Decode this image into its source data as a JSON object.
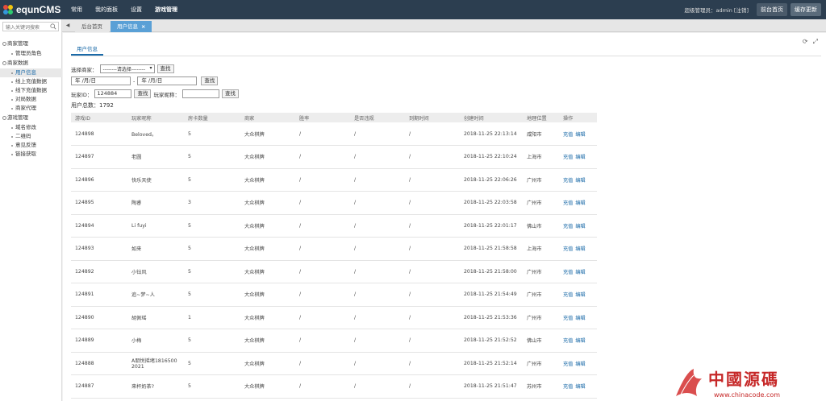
{
  "app": {
    "logo_text": "equnCMS"
  },
  "topnav": [
    "常用",
    "我的面板",
    "设置",
    "游戏管理"
  ],
  "topright": {
    "user": "超级管理员：admin [注销]",
    "home_button": "前台首页",
    "cache_button": "缓存更新"
  },
  "sidebar": {
    "search_placeholder": "输入关键词搜索",
    "groups": [
      {
        "label": "商家管理",
        "items": [
          "管理员角色"
        ]
      },
      {
        "label": "商家数据",
        "items": [
          "用户信息",
          "线上充值数据",
          "线下充值数据",
          "对局数据",
          "商家代理"
        ]
      },
      {
        "label": "游戏管理",
        "items": [
          "域名修改",
          "二维码",
          "意见反馈",
          "链接获取"
        ]
      }
    ]
  },
  "tabs": {
    "home": "后台首页",
    "active": "用户信息",
    "close": "×"
  },
  "page": {
    "subtab": "用户信息",
    "filter": {
      "merchant_label": "选择商家：",
      "merchant_value": "--------请选择--------",
      "search": "查找",
      "date_from": "年 /月/日",
      "date_sep": "-",
      "date_to": "年 /月/日",
      "player_id_label": "玩家ID：",
      "player_id_value": "124884",
      "nickname_label": "玩家昵称：",
      "nickname_value": ""
    },
    "total": "用户总数：1792"
  },
  "table": {
    "headers": [
      "游戏ID",
      "玩家昵称",
      "房卡数量",
      "商家",
      "胜率",
      "是否违规",
      "到期时间",
      "创建时间",
      "地理位置",
      "操作"
    ],
    "op_recharge": "充值",
    "op_edit": "编辑",
    "rows": [
      [
        "124898",
        "Beloved。",
        "5",
        "大众棋牌",
        "/",
        "/",
        "/",
        "2018-11-25 22:13:14",
        "咸阳市"
      ],
      [
        "124897",
        "老圆",
        "5",
        "大众棋牌",
        "/",
        "/",
        "/",
        "2018-11-25 22:10:24",
        "上海市"
      ],
      [
        "124896",
        "快乐天使",
        "5",
        "大众棋牌",
        "/",
        "/",
        "/",
        "2018-11-25 22:06:26",
        "广州市"
      ],
      [
        "124895",
        "陶睿",
        "3",
        "大众棋牌",
        "/",
        "/",
        "/",
        "2018-11-25 22:03:58",
        "广州市"
      ],
      [
        "124894",
        "Li fuyi",
        "5",
        "大众棋牌",
        "/",
        "/",
        "/",
        "2018-11-25 22:01:17",
        "佛山市"
      ],
      [
        "124893",
        "如来",
        "5",
        "大众棋牌",
        "/",
        "/",
        "/",
        "2018-11-25 21:58:58",
        "上海市"
      ],
      [
        "124892",
        "小钻风",
        "5",
        "大众棋牌",
        "/",
        "/",
        "/",
        "2018-11-25 21:58:00",
        "广州市"
      ],
      [
        "124891",
        "追~梦~人",
        "5",
        "大众棋牌",
        "/",
        "/",
        "/",
        "2018-11-25 21:54:49",
        "广州市"
      ],
      [
        "124890",
        "胡佩瑶",
        "1",
        "大众棋牌",
        "/",
        "/",
        "/",
        "2018-11-25 21:53:36",
        "广州市"
      ],
      [
        "124889",
        "小梅",
        "5",
        "大众棋牌",
        "/",
        "/",
        "/",
        "2018-11-25 21:52:52",
        "佛山市"
      ],
      [
        "124888",
        "A朋悦摇堵1816500 2021",
        "5",
        "大众棋牌",
        "/",
        "/",
        "/",
        "2018-11-25 21:52:14",
        "广州市"
      ],
      [
        "124887",
        "来杯奶茶?",
        "5",
        "大众棋牌",
        "/",
        "/",
        "/",
        "2018-11-25 21:51:47",
        "苏州市"
      ]
    ]
  },
  "watermark": {
    "text": "中國源碼",
    "url": "www.chinacode.com"
  },
  "colors": {
    "topbar": "#2c3e50",
    "accent": "#1a6aa8",
    "tab_active": "#5aa0d6",
    "watermark": "#c62828"
  }
}
